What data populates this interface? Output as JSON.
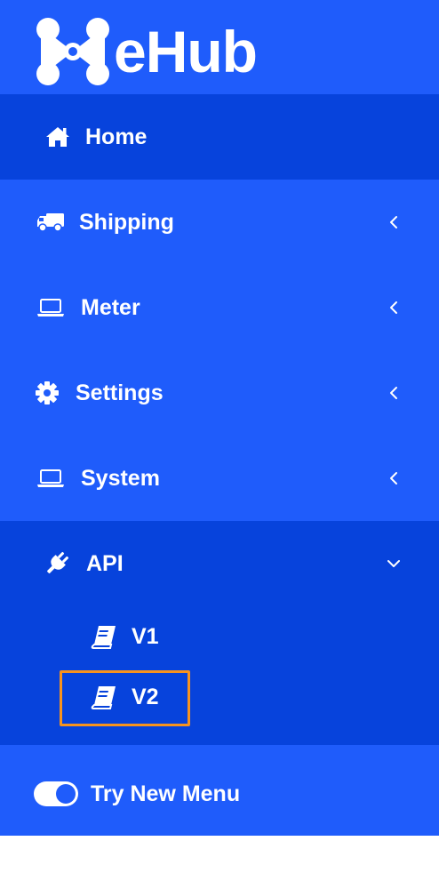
{
  "brand": {
    "name": "eHub",
    "logo_icon": "ehub-logo-icon"
  },
  "colors": {
    "sidebar_bg": "#1f5cfb",
    "active_bg": "#0743dc",
    "text": "#ffffff",
    "highlight": "#f7931e"
  },
  "nav": {
    "home": {
      "label": "Home",
      "icon": "home-icon"
    },
    "shipping": {
      "label": "Shipping",
      "icon": "truck-icon"
    },
    "meter": {
      "label": "Meter",
      "icon": "laptop-icon"
    },
    "settings": {
      "label": "Settings",
      "icon": "gear-icon"
    },
    "system": {
      "label": "System",
      "icon": "laptop-icon"
    },
    "api": {
      "label": "API",
      "icon": "plug-icon",
      "expanded": true,
      "children": [
        {
          "label": "V1",
          "icon": "book-icon"
        },
        {
          "label": "V2",
          "icon": "book-icon",
          "highlighted": true
        }
      ]
    }
  },
  "footer": {
    "toggle_label": "Try New Menu",
    "toggle_on": true
  }
}
